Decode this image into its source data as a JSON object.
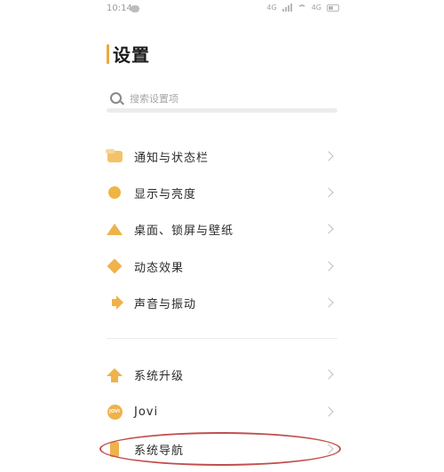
{
  "status_bar": {
    "time": "10:14",
    "network_label": "4G",
    "speed_label": "4G",
    "wechat_icon": "wechat-icon",
    "signal_icon": "signal-icon",
    "wifi_icon": "wifi-icon",
    "battery_icon": "battery-icon"
  },
  "header": {
    "title": "设置",
    "accent_color": "#f1a63a"
  },
  "search": {
    "placeholder": "搜索设置项"
  },
  "groups": [
    {
      "items": [
        {
          "label": "通知与状态栏",
          "icon": "notification-icon"
        },
        {
          "label": "显示与亮度",
          "icon": "display-icon"
        },
        {
          "label": "桌面、锁屏与壁纸",
          "icon": "desktop-icon"
        },
        {
          "label": "动态效果",
          "icon": "animation-icon"
        },
        {
          "label": "声音与振动",
          "icon": "sound-icon"
        }
      ]
    },
    {
      "items": [
        {
          "label": "系统升级",
          "icon": "upgrade-icon"
        },
        {
          "label": "Jovi",
          "icon": "jovi-icon",
          "icon_text": "JOVI"
        },
        {
          "label": "系统导航",
          "icon": "navigation-icon"
        }
      ]
    }
  ],
  "annotation": {
    "highlighted_item": "系统导航",
    "color": "#c0504d"
  }
}
